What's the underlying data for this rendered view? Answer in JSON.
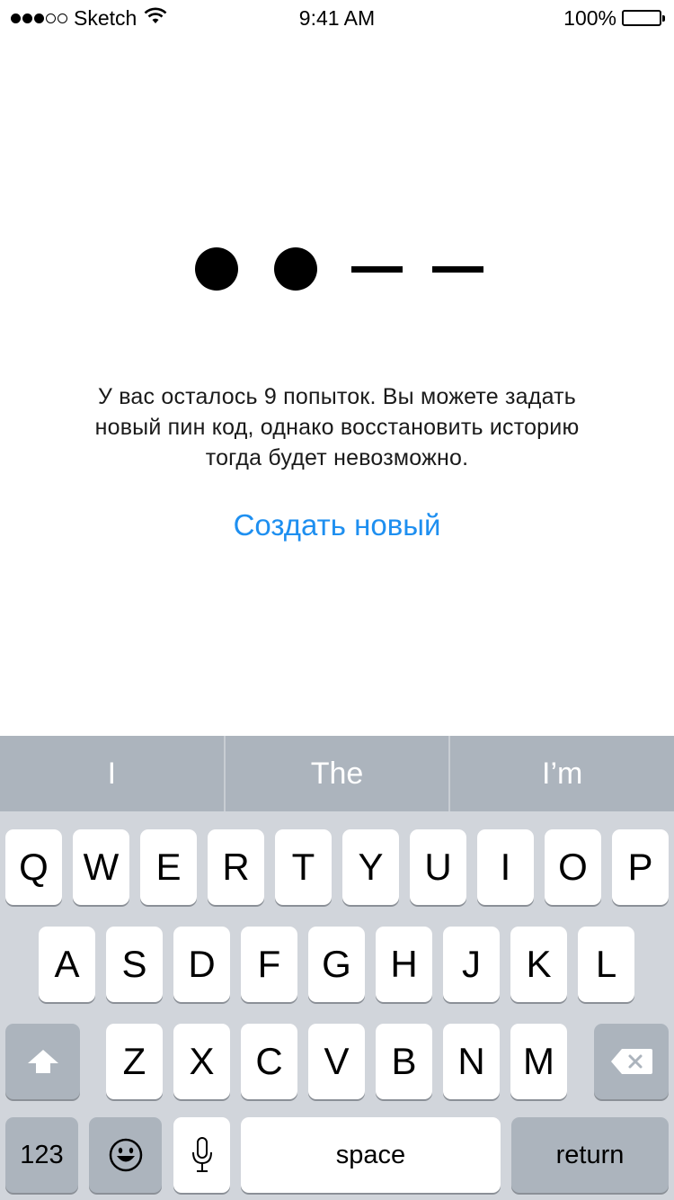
{
  "status_bar": {
    "signal_filled": 3,
    "signal_total": 5,
    "carrier": "Sketch",
    "time": "9:41 AM",
    "battery_percent": "100%",
    "battery_level": 1.0
  },
  "pin": {
    "length": 4,
    "entered": 2
  },
  "message": "У вас осталось 9 попыток. Вы можете задать\nновый пин код, однако восстановить историю\nтогда будет невозможно.",
  "create_new_label": "Создать новый",
  "link_color": "#1e8ff0",
  "keyboard": {
    "suggestions": [
      "I",
      "The",
      "I’m"
    ],
    "row1": [
      "Q",
      "W",
      "E",
      "R",
      "T",
      "Y",
      "U",
      "I",
      "O",
      "P"
    ],
    "row2": [
      "A",
      "S",
      "D",
      "F",
      "G",
      "H",
      "J",
      "K",
      "L"
    ],
    "row3": [
      "Z",
      "X",
      "C",
      "V",
      "B",
      "N",
      "M"
    ],
    "shift_icon": "shift-arrow-icon",
    "delete_icon": "backspace-icon",
    "numbers_label": "123",
    "emoji_icon": "emoji-icon",
    "mic_icon": "microphone-icon",
    "space_label": "space",
    "return_label": "return"
  }
}
